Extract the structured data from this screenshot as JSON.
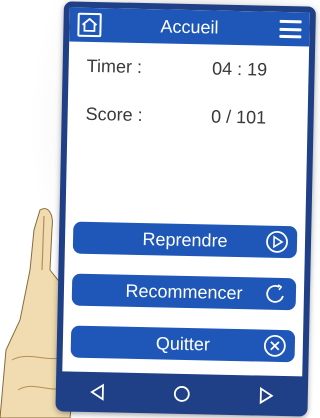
{
  "header": {
    "title": "Accueil",
    "home_icon": "home-icon",
    "menu_icon": "hamburger-menu-icon"
  },
  "stats": {
    "timer_label": "Timer :",
    "timer_value": "04 : 19",
    "score_label": "Score :",
    "score_value": "0 / 101"
  },
  "actions": [
    {
      "label": "Reprendre",
      "icon": "play-circle-icon"
    },
    {
      "label": "Recommencer",
      "icon": "restart-circle-icon"
    },
    {
      "label": "Quitter",
      "icon": "close-circle-icon"
    }
  ],
  "navbar": {
    "icons": [
      "back-triangle-icon",
      "home-circle-icon",
      "forward-triangle-icon"
    ]
  },
  "colors": {
    "primary": "#1f57b8",
    "phone_frame": "#1f3f86",
    "text": "#3a3a3a"
  }
}
